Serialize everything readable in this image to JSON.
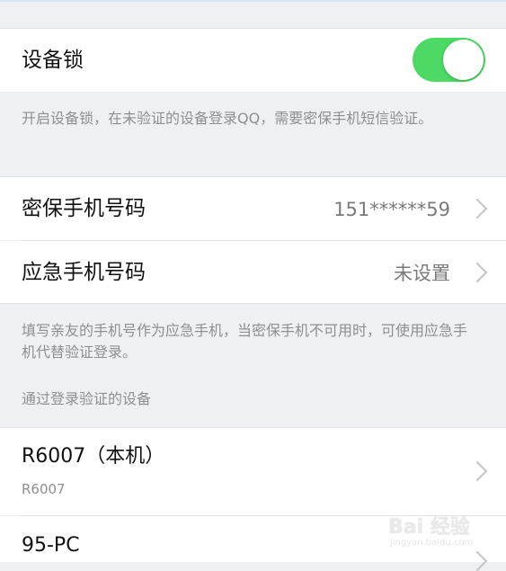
{
  "device_lock": {
    "label": "设备锁",
    "enabled": true,
    "description": "开启设备锁，在未验证的设备登录QQ，需要密保手机短信验证。"
  },
  "security_phone": {
    "label": "密保手机号码",
    "value": "151******59"
  },
  "emergency_phone": {
    "label": "应急手机号码",
    "value": "未设置",
    "description": "填写亲友的手机号作为应急手机，当密保手机不可用时，可使用应急手机代替验证登录。"
  },
  "verified_devices": {
    "header": "通过登录验证的设备",
    "items": [
      {
        "name": "R6007（本机）",
        "model": "R6007"
      },
      {
        "name": "95-PC",
        "model": ""
      }
    ]
  },
  "watermark": {
    "brand": "Bai 经验",
    "url": "jingyan.baidu.com"
  },
  "colors": {
    "toggle_on": "#4cd964",
    "background": "#eff0f4"
  }
}
